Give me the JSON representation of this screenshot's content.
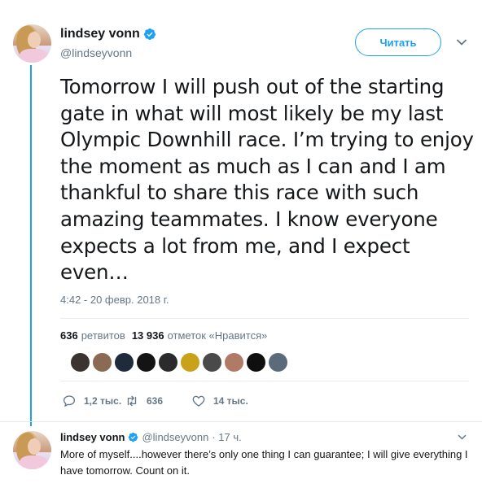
{
  "tweet": {
    "author_name": "lindsey vonn",
    "handle": "@lindseyvonn",
    "follow_label": "Читать",
    "text": "Tomorrow I will push out of the starting gate in what will most likely be my last Olympic Downhill race. I’m trying to enjoy the moment as much as I can and I am thankful to share this race with such amazing teammates. I know everyone expects a lot from me, and I expect even…",
    "timestamp": "4:42 - 20 февр. 2018 г.",
    "retweets_count": "636",
    "retweets_label": "ретвитов",
    "likes_count": "13 936",
    "likes_label": "отметок «Нравится»",
    "liker_colors": [
      "#3a3330",
      "#8a6a52",
      "#1f2a3a",
      "#141414",
      "#2b2b2b",
      "#c9a21a",
      "#4a4a4a",
      "#b07a66",
      "#0f0f0f",
      "#5b6b7a"
    ],
    "actions": {
      "reply_count": "1,2 тыс.",
      "retweet_count": "636",
      "like_count": "14 тыс."
    },
    "accent_color": "#1da1f2"
  },
  "reply": {
    "author_name": "lindsey vonn",
    "handle": "@lindseyvonn",
    "time": "· 17 ч.",
    "text": "More of myself....however there’s only one thing I can guarantee;  I will give everything I have tomorrow. Count on it."
  }
}
